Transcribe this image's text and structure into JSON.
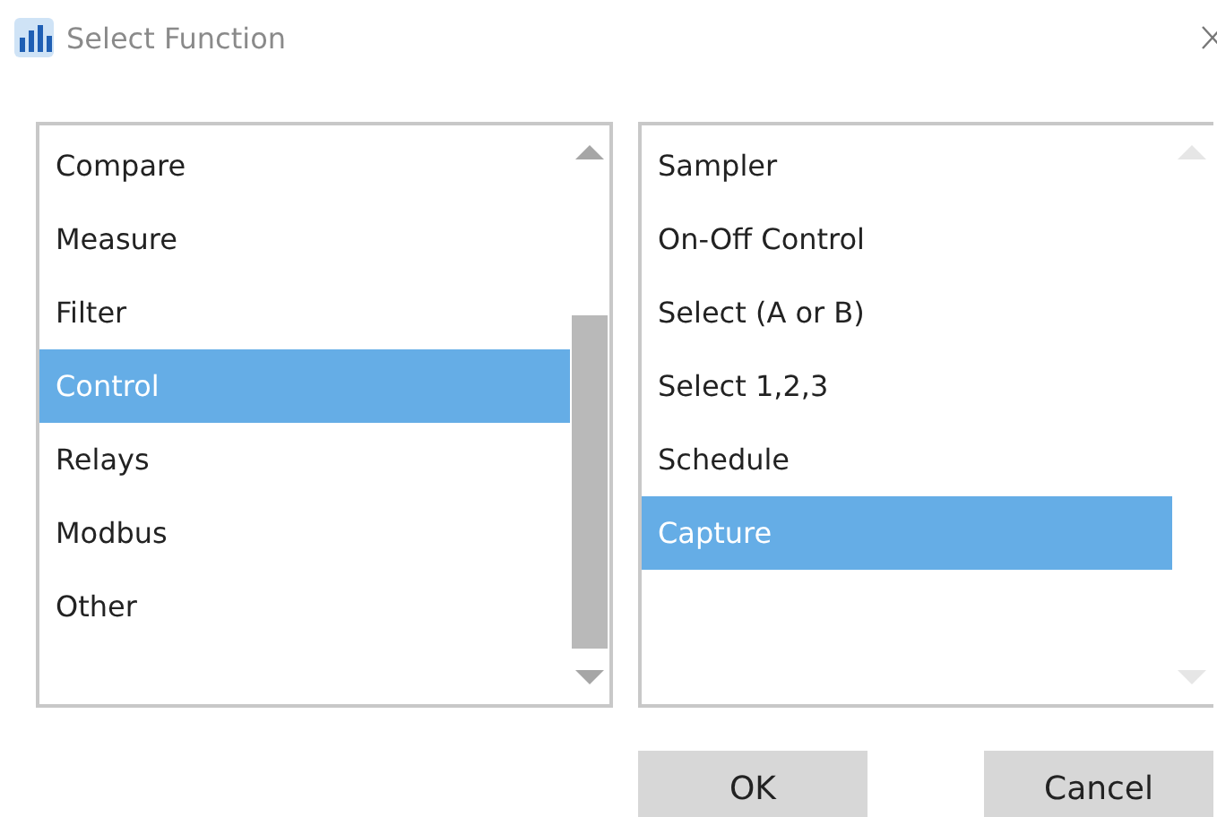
{
  "window": {
    "title": "Select Function"
  },
  "categories": [
    {
      "label": "Compare",
      "selected": false
    },
    {
      "label": "Measure",
      "selected": false
    },
    {
      "label": "Filter",
      "selected": false
    },
    {
      "label": "Control",
      "selected": true
    },
    {
      "label": "Relays",
      "selected": false
    },
    {
      "label": "Modbus",
      "selected": false
    },
    {
      "label": "Other",
      "selected": false
    }
  ],
  "functions": [
    {
      "label": "Sampler",
      "selected": false
    },
    {
      "label": "On-Off Control",
      "selected": false
    },
    {
      "label": "Select (A or B)",
      "selected": false
    },
    {
      "label": "Select 1,2,3",
      "selected": false
    },
    {
      "label": "Schedule",
      "selected": false
    },
    {
      "label": "Capture",
      "selected": true
    }
  ],
  "buttons": [
    "OK",
    "Cancel"
  ]
}
